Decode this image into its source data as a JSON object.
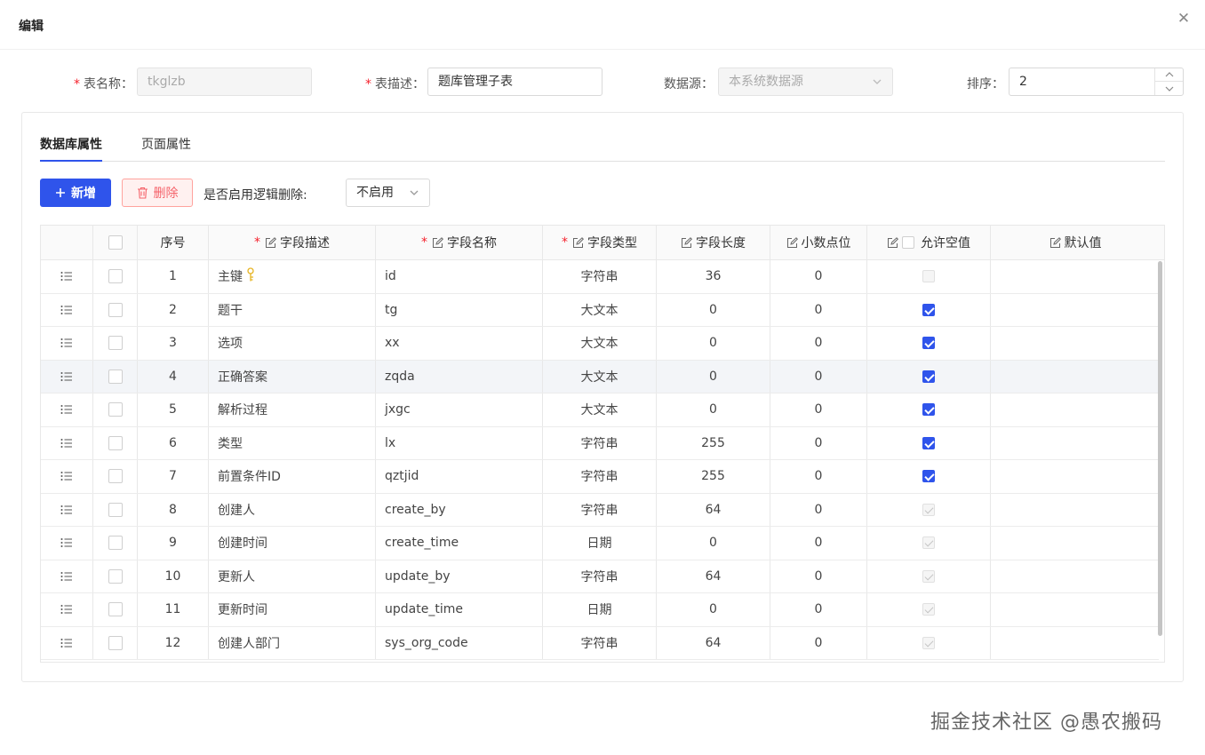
{
  "modal": {
    "title": "编辑"
  },
  "form": {
    "table_name_label": "表名称：",
    "table_name_value": "tkglzb",
    "table_desc_label": "表描述：",
    "table_desc_value": "题库管理子表",
    "datasource_label": "数据源：",
    "datasource_value": "本系统数据源",
    "sort_label": "排序：",
    "sort_value": "2"
  },
  "tabs": [
    {
      "label": "数据库属性"
    },
    {
      "label": "页面属性"
    }
  ],
  "toolbar": {
    "add_label": "新增",
    "delete_label": "删除",
    "logic_delete_label": "是否启用逻辑删除:",
    "logic_delete_value": "不启用"
  },
  "table": {
    "headers": {
      "seq": "序号",
      "desc": "字段描述",
      "name": "字段名称",
      "type": "字段类型",
      "length": "字段长度",
      "decimal": "小数点位",
      "nullable": "允许空值",
      "default": "默认值"
    },
    "rows": [
      {
        "seq": "1",
        "desc": "主键",
        "name": "id",
        "type": "字符串",
        "length": "36",
        "decimal": "0",
        "nullable": "disabled"
      },
      {
        "seq": "2",
        "desc": "题干",
        "name": "tg",
        "type": "大文本",
        "length": "0",
        "decimal": "0",
        "nullable": "checked"
      },
      {
        "seq": "3",
        "desc": "选项",
        "name": "xx",
        "type": "大文本",
        "length": "0",
        "decimal": "0",
        "nullable": "checked"
      },
      {
        "seq": "4",
        "desc": "正确答案",
        "name": "zqda",
        "type": "大文本",
        "length": "0",
        "decimal": "0",
        "nullable": "checked"
      },
      {
        "seq": "5",
        "desc": "解析过程",
        "name": "jxgc",
        "type": "大文本",
        "length": "0",
        "decimal": "0",
        "nullable": "checked"
      },
      {
        "seq": "6",
        "desc": "类型",
        "name": "lx",
        "type": "字符串",
        "length": "255",
        "decimal": "0",
        "nullable": "checked"
      },
      {
        "seq": "7",
        "desc": "前置条件ID",
        "name": "qztjid",
        "type": "字符串",
        "length": "255",
        "decimal": "0",
        "nullable": "checked"
      },
      {
        "seq": "8",
        "desc": "创建人",
        "name": "create_by",
        "type": "字符串",
        "length": "64",
        "decimal": "0",
        "nullable": "disabled-checked"
      },
      {
        "seq": "9",
        "desc": "创建时间",
        "name": "create_time",
        "type": "日期",
        "length": "0",
        "decimal": "0",
        "nullable": "disabled-checked"
      },
      {
        "seq": "10",
        "desc": "更新人",
        "name": "update_by",
        "type": "字符串",
        "length": "64",
        "decimal": "0",
        "nullable": "disabled-checked"
      },
      {
        "seq": "11",
        "desc": "更新时间",
        "name": "update_time",
        "type": "日期",
        "length": "0",
        "decimal": "0",
        "nullable": "disabled-checked"
      },
      {
        "seq": "12",
        "desc": "创建人部门",
        "name": "sys_org_code",
        "type": "字符串",
        "length": "64",
        "decimal": "0",
        "nullable": "disabled-checked"
      }
    ]
  },
  "watermark": "掘金技术社区 @愚农搬码",
  "colors": {
    "primary": "#2f54eb",
    "danger": "#f5636a",
    "required": "#f5222d",
    "key_icon": "#e6b422"
  }
}
